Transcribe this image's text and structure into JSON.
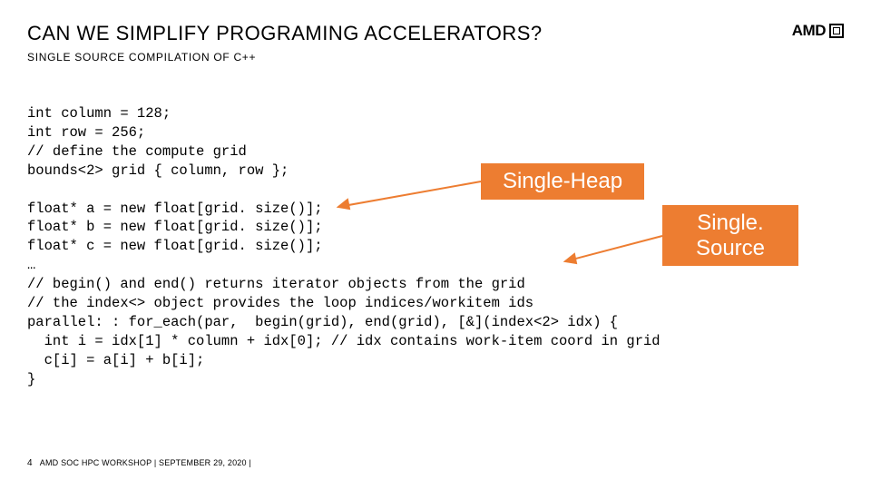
{
  "title": "CAN WE SIMPLIFY PROGRAMING ACCELERATORS?",
  "subtitle": "SINGLE SOURCE COMPILATION OF C++",
  "logo": "AMD",
  "code_lines": [
    "int column = 128;",
    "int row = 256;",
    "// define the compute grid",
    "bounds<2> grid { column, row };",
    "",
    "float* a = new float[grid. size()];",
    "float* b = new float[grid. size()];",
    "float* c = new float[grid. size()];",
    "…",
    "// begin() and end() returns iterator objects from the grid",
    "// the index<> object provides the loop indices/workitem ids",
    "parallel: : for_each(par,  begin(grid), end(grid), [&](index<2> idx) {",
    "  int i = idx[1] * column + idx[0]; // idx contains work-item coord in grid",
    "  c[i] = a[i] + b[i];",
    "}"
  ],
  "callouts": {
    "heap": "Single-Heap",
    "source_l1": "Single.",
    "source_l2": "Source"
  },
  "footer": {
    "page": "4",
    "text": "AMD SOC HPC WORKSHOP |  SEPTEMBER 29, 2020  |"
  }
}
